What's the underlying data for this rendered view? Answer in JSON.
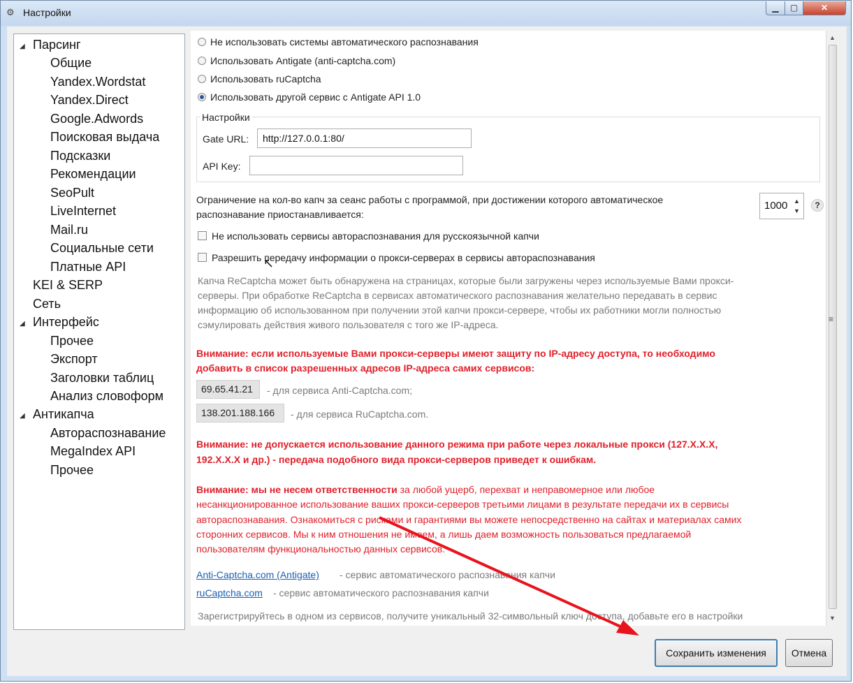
{
  "window": {
    "title": "Настройки",
    "app_icon": "⚙",
    "min_glyph": "▁",
    "max_glyph": "▢",
    "close_glyph": "✕"
  },
  "tree": {
    "items": [
      {
        "label": "Парсинг",
        "expanded": true
      },
      {
        "label": "Общие"
      },
      {
        "label": "Yandex.Wordstat"
      },
      {
        "label": "Yandex.Direct"
      },
      {
        "label": "Google.Adwords"
      },
      {
        "label": "Поисковая выдача"
      },
      {
        "label": "Подсказки"
      },
      {
        "label": "Рекомендации"
      },
      {
        "label": "SeoPult"
      },
      {
        "label": "LiveInternet"
      },
      {
        "label": "Mail.ru"
      },
      {
        "label": "Социальные сети"
      },
      {
        "label": "Платные API"
      },
      {
        "label": "KEI & SERP"
      },
      {
        "label": "Сеть"
      },
      {
        "label": "Интерфейс",
        "expanded": true
      },
      {
        "label": "Прочее"
      },
      {
        "label": "Экспорт"
      },
      {
        "label": "Заголовки таблиц"
      },
      {
        "label": "Анализ словоформ"
      },
      {
        "label": "Антикапча",
        "expanded": true,
        "selected": true
      },
      {
        "label": "Автораспознавание"
      },
      {
        "label": "MegaIndex API"
      },
      {
        "label": "Прочее"
      }
    ],
    "expand_glyph": "◢"
  },
  "recognition": {
    "options": [
      {
        "label": "Не использовать системы автоматического распознавания",
        "checked": false
      },
      {
        "label": "Использовать Antigate (anti-captcha.com)",
        "checked": false
      },
      {
        "label": "Использовать ruCaptcha",
        "checked": false
      },
      {
        "label": "Использовать другой сервис с Antigate API 1.0",
        "checked": true
      }
    ]
  },
  "settings_group": {
    "title": "Настройки",
    "gate_url_label": "Gate URL:",
    "gate_url_value": "http://127.0.0.1:80/",
    "api_key_label": "API Key:",
    "api_key_value": ""
  },
  "limit": {
    "line1": "Ограничение на кол-во капч за сеанс работы с программой, при достижении которого автоматическое",
    "line2": "распознавание приостанавливается:",
    "value": "1000",
    "up_glyph": "▲",
    "down_glyph": "▼",
    "help": "?"
  },
  "checkboxes": [
    {
      "label": "Не использовать сервисы автораспознавания для русскоязычной капчи",
      "checked": false
    },
    {
      "label": "Разрешить передачу информации о прокси-серверах в сервисы автораспознавания",
      "checked": false
    }
  ],
  "info_gray": [
    "Капча ReCaptcha может быть обнаружена на страницах, которые были загружены через используемые Вами прокси-",
    "серверы. При обработке ReCaptcha в сервисах автоматического распознавания желательно передавать в сервис",
    "информацию об использованном при получении этой капчи прокси-сервере, чтобы их работники могли полностью",
    "сэмулировать действия живого пользователя с того же IP-адреса."
  ],
  "warning1": [
    "Внимание: если используемые Вами прокси-серверы имеют защиту по IP-адресу доступа, то необходимо",
    "добавить в список разрешенных адресов IP-адреса самих сервисов:"
  ],
  "ips": [
    {
      "ip": "69.65.41.21",
      "desc": "- для сервиса Anti-Captcha.com;"
    },
    {
      "ip": "138.201.188.166",
      "desc": "- для сервиса RuCaptcha.com."
    }
  ],
  "warning2": [
    "Внимание: не допускается использование данного режима при работе через локальные прокси (127.X.X.X,",
    "192.X.X.X и др.) - передача подобного вида прокси-серверов приведет к ошибкам."
  ],
  "warning3": {
    "bold": "Внимание: мы не несем ответственности",
    "line1_rest": " за любой ущерб, перехват и неправомерное или любое",
    "lines": [
      "несанкционированное использование ваших прокси-серверов третьими лицами в результате передачи их в сервисы",
      "автораспознавания. Ознакомиться с рисками и гарантиями вы можете непосредственно на сайтах и материалах самих",
      "сторонних сервисов. Мы к ним отношения не имеем, а лишь даем возможность пользоваться предлагаемой",
      "пользователям функциональностью данных сервисов."
    ]
  },
  "links": [
    {
      "text": "Anti-Captcha.com (Antigate)",
      "desc": "- сервис автоматического распознавания капчи"
    },
    {
      "text": "ruCaptcha.com",
      "desc": "- сервис автоматического распознавания капчи"
    }
  ],
  "bottom_note": "Зарегистрируйтесь в одном из сервисов, получите уникальный 32-символьный ключ доступа, добавьте его в настройки",
  "scroll": {
    "up": "▲",
    "down": "▼",
    "grip": "≡"
  },
  "buttons": {
    "save": "Сохранить изменения",
    "cancel": "Отмена"
  },
  "colors": {
    "warning": "#e0202a",
    "link": "#1a5fb4",
    "annotation_arrow": "#e8131c"
  }
}
